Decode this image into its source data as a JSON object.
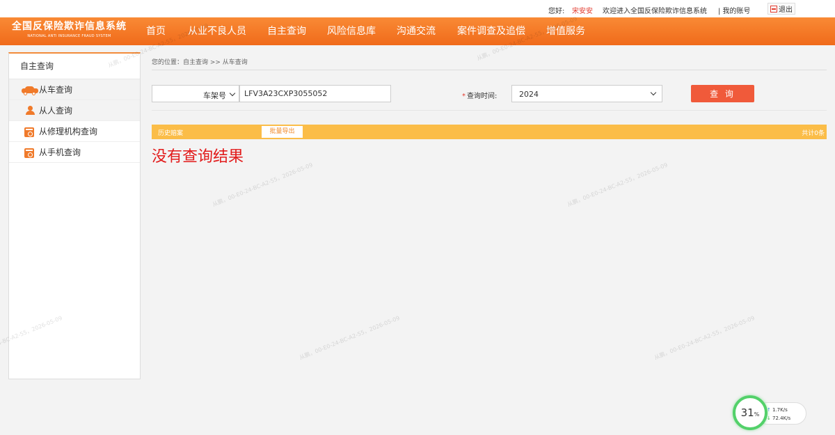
{
  "topbar": {
    "greeting": "您好:",
    "username": "宋安安",
    "welcome": "欢迎进入全国反保险欺诈信息系统",
    "account": "| 我的账号",
    "logout": "退出"
  },
  "header": {
    "logo_cn": "全国反保险欺诈信息系统",
    "logo_en": "NATIONAL ANTI INSURANCE FRAUD SYSTEM",
    "nav": [
      "首页",
      "从业不良人员",
      "自主查询",
      "风险信息库",
      "沟通交流",
      "案件调查及追偿",
      "增值服务"
    ]
  },
  "sidebar": {
    "title": "自主查询",
    "items": [
      {
        "label": "从车查询",
        "icon": "car-icon"
      },
      {
        "label": "从人查询",
        "icon": "person-icon"
      },
      {
        "label": "从修理机构查询",
        "icon": "repair-shop-icon"
      },
      {
        "label": "从手机查询",
        "icon": "phone-query-icon"
      }
    ]
  },
  "main": {
    "breadcrumb": "您的位置：自主查询 >> 从车查询",
    "search_type": "车架号",
    "vin_value": "LFV3A23CXP3055052",
    "query_time_label": "查询时间:",
    "query_time_required": "*",
    "year_value": "2024",
    "query_button": "查 询",
    "history_label": "历史赔案",
    "export_button": "批量导出",
    "total_label": "共计0条",
    "no_result": "没有查询结果"
  },
  "watermark": "从鹏，00-E0-24-BC-A2-55，2026-05-09",
  "speed_widget": {
    "percent": "31",
    "percent_unit": "%",
    "upload": "1.7K/s",
    "download": "72.4K/s",
    "up_arrow": "↑",
    "down_arrow": "↓"
  },
  "colors": {
    "header_orange": "#f06a1a",
    "result_bar": "#fbbd48",
    "query_button": "#f05a3a",
    "no_result_red": "#e21a1a",
    "ring_green": "#53d16a"
  }
}
